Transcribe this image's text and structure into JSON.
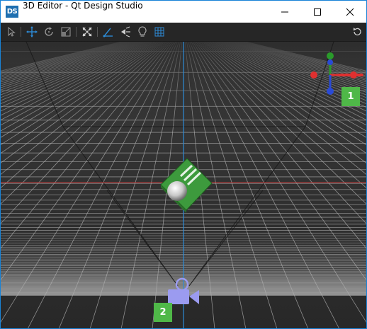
{
  "window": {
    "app_icon_text": "DS",
    "title": "3D Editor - Qt Design Studio"
  },
  "toolbar": {
    "buttons": [
      "select-arrow-icon",
      "move-icon",
      "rotate-icon",
      "scale-icon",
      "fit-selected-icon",
      "camera-perspective-icon",
      "light-toggle-icon",
      "lightbulb-icon",
      "grid-icon",
      "reset-view-icon"
    ],
    "active_button": "move-icon"
  },
  "viewport": {
    "gizmo_axes": [
      "y-green",
      "x-red",
      "z-blue"
    ],
    "callouts": {
      "one": "1",
      "two": "2"
    },
    "colors": {
      "grid": "#b0b0b0",
      "x_axis": "#c23a3a",
      "z_axis": "#2d8bd6",
      "cube": "#3d9a3d",
      "camera": "#9b9bf0",
      "callout": "#4fb848"
    }
  }
}
